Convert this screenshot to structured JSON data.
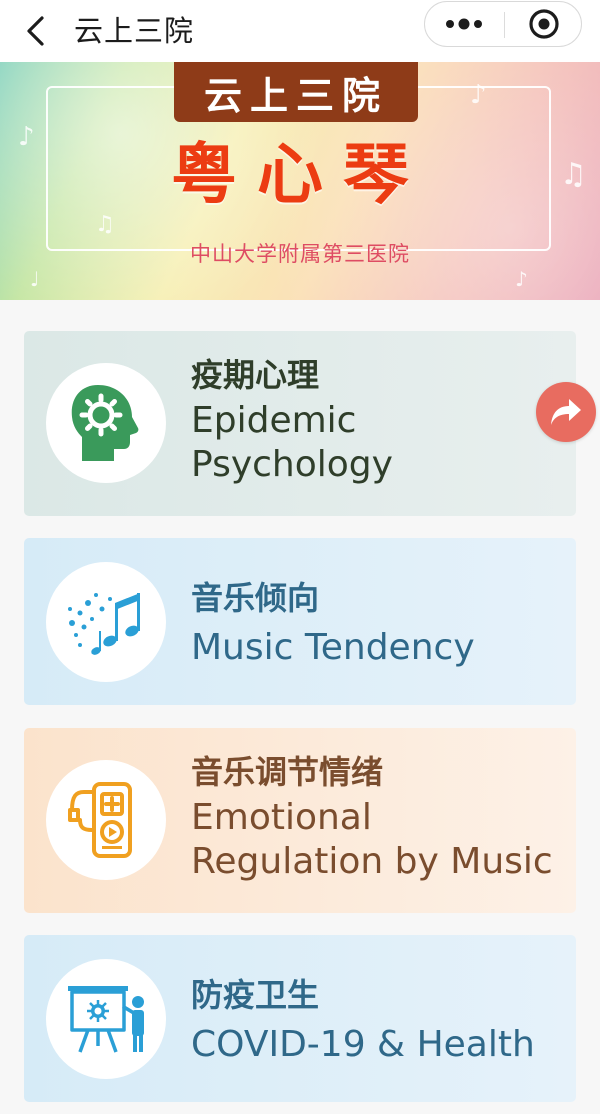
{
  "nav": {
    "title": "云上三院",
    "back_icon": "chevron-left-icon",
    "more_icon": "more-dots-icon",
    "close_icon": "target-close-icon"
  },
  "banner": {
    "tag": "云上三院",
    "title": "粤心琴",
    "subtitle": "中山大学附属第三医院"
  },
  "cards": [
    {
      "title_cn": "疫期心理",
      "title_en_1": "Epidemic",
      "title_en_2": "Psychology",
      "icon": "head-gear-icon",
      "color": "#3a9a5b"
    },
    {
      "title_cn": "音乐倾向",
      "title_en_1": "Music Tendency",
      "icon": "music-notes-icon",
      "color": "#2a9fd6"
    },
    {
      "title_cn": "音乐调节情绪",
      "title_en_1": "Emotional",
      "title_en_2": "Regulation by Music",
      "icon": "music-player-icon",
      "color": "#f0a020"
    },
    {
      "title_cn": "防疫卫生",
      "title_en_1": "COVID-19 & Health",
      "icon": "virus-presentation-icon",
      "color": "#2a9fd6"
    }
  ],
  "share": {
    "icon": "share-arrow-icon",
    "color": "#e86c60"
  }
}
